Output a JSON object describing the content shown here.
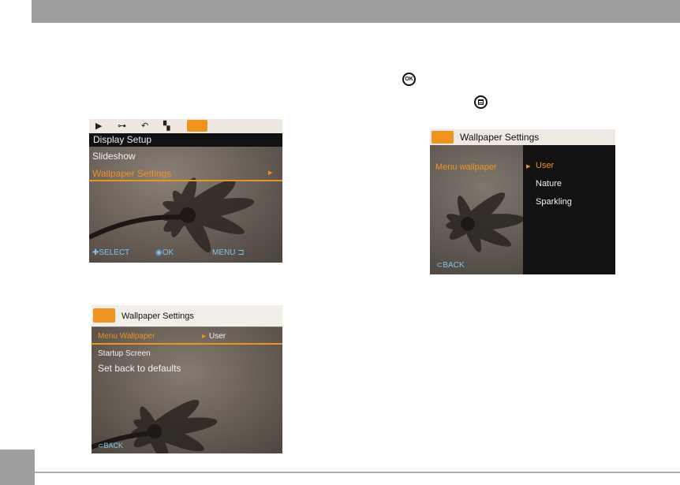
{
  "icons": {
    "ok_button": "OK",
    "menu_button": "menu-button-icon"
  },
  "screen1": {
    "tabs": [
      "▶",
      "⊶",
      "↶",
      "▚",
      "▭"
    ],
    "header": "Display Setup",
    "items": [
      "Slideshow",
      "Wallpaper Settings"
    ],
    "selected_arrow": "▸",
    "footer": {
      "select": "SELECT",
      "ok": "OK",
      "menu": "MENU"
    }
  },
  "screen2": {
    "header": "Wallpaper Settings",
    "left_label": "Menu wallpaper",
    "options": [
      "User",
      "Nature",
      "Sparkling"
    ],
    "selected_marker": "▸",
    "back": "BACK"
  },
  "screen3": {
    "header": "Wallpaper Settings",
    "items": [
      "Menu Wallpaper",
      "Startup Screen",
      "Set back to defaults"
    ],
    "value": "User",
    "value_marker": "▸",
    "back": "BACK"
  },
  "colors": {
    "accent": "#f0921e",
    "footer_text": "#7fc4ee"
  }
}
